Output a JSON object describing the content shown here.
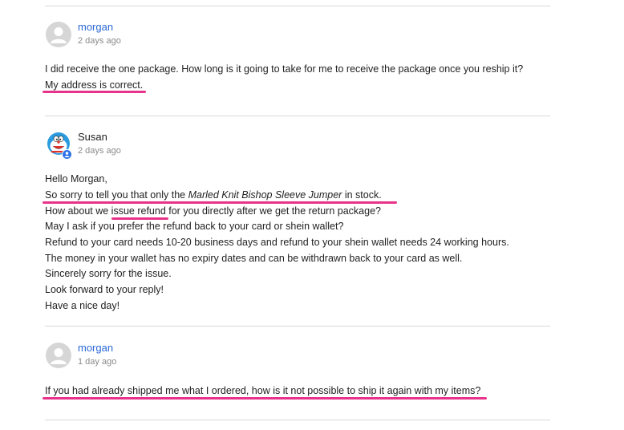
{
  "comments": [
    {
      "author": "morgan",
      "time": "2 days ago",
      "lines": [
        "I did receive the one package. How long is it going to take for me to receive the package once you reship it?",
        "My address is correct."
      ]
    },
    {
      "author": "Susan",
      "time": "2 days ago",
      "lines": {
        "l1": "Hello Morgan,",
        "l2_a": "So sorry to tell you that only the ",
        "l2_b": "Marled Knit Bishop Sleeve Jumper",
        "l2_c": " in stock.",
        "l3": "How about we issue refund for you directly after we get the return package?",
        "l4": "May I ask if you prefer the refund back to your card or shein wallet?",
        "l5": "Refund to your card needs 10-20 business days and refund to your shein wallet needs 24 working hours.",
        "l6": "The money in your wallet has no expiry dates and can be withdrawn back to your card as well.",
        "l7": "Sincerely sorry for the issue.",
        "l8": "Look forward to your reply!",
        "l9": "Have a nice day!"
      }
    },
    {
      "author": "morgan",
      "time": "1 day ago",
      "lines": [
        "If you had already shipped me what I ordered, how is it not possible to ship it again with my items?"
      ]
    }
  ],
  "colors": {
    "author_link": "#2b69d6",
    "highlight": "#e8338a",
    "divider": "#d9d9d9",
    "staff_badge": "#2d72e8"
  },
  "icons": {
    "default_avatar": "user-silhouette-icon",
    "susan_avatar": "doraemon-avatar-icon",
    "staff_badge": "staff-person-icon"
  }
}
